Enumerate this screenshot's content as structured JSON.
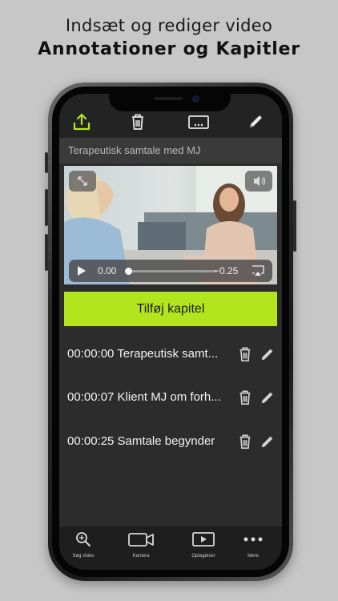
{
  "promo": {
    "line1": "Indsæt og rediger video",
    "line2": "Annotationer og Kapitler"
  },
  "toolbar": {
    "icons": [
      "share-icon",
      "trash-icon",
      "subtitle-icon",
      "pencil-icon"
    ],
    "accent": "#b2e51d"
  },
  "video_title": "Terapeutisk samtale med MJ",
  "player": {
    "current_time": "0.00",
    "remaining_time": "−0.25",
    "progress": 0.0
  },
  "add_chapter_label": "Tilføj kapitel",
  "chapters": [
    {
      "label": "00:00:00 Terapeutisk samt..."
    },
    {
      "label": "00:00:07 Klient MJ om forh..."
    },
    {
      "label": "00:00:25 Samtale begynder"
    }
  ],
  "tabs": [
    {
      "label": "Søg video",
      "icon": "search-icon"
    },
    {
      "label": "Kamera",
      "icon": "camera-icon"
    },
    {
      "label": "Optagelser",
      "icon": "recordings-icon"
    },
    {
      "label": "Mere",
      "icon": "more-icon"
    }
  ],
  "colors": {
    "accent": "#b2e51d",
    "background": "#2c2c2c",
    "page": "#c7c7c7"
  }
}
